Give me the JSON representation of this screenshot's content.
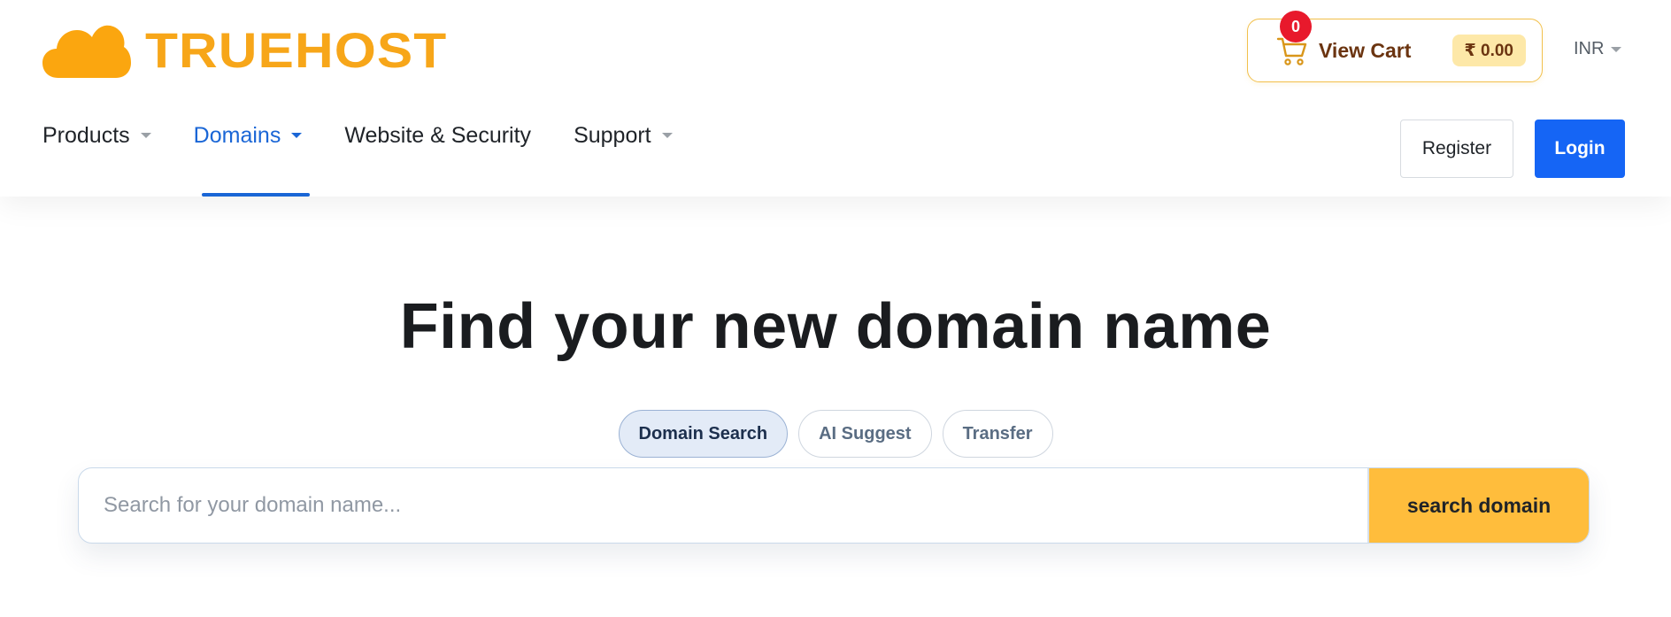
{
  "brand": {
    "name": "TRUEHOST",
    "color": "#f7a619",
    "logo_icon": "cloud-icon"
  },
  "cart": {
    "count": "0",
    "label": "View Cart",
    "total": "₹ 0.00",
    "icon": "shopping-cart-icon"
  },
  "currency": {
    "selected": "INR"
  },
  "nav": {
    "items": [
      {
        "label": "Products",
        "has_dropdown": true,
        "active": false
      },
      {
        "label": "Domains",
        "has_dropdown": true,
        "active": true
      },
      {
        "label": "Website & Security",
        "has_dropdown": false,
        "active": false
      },
      {
        "label": "Support",
        "has_dropdown": true,
        "active": false
      }
    ],
    "register_label": "Register",
    "login_label": "Login"
  },
  "hero": {
    "title": "Find your new domain name",
    "tabs": [
      {
        "label": "Domain Search",
        "selected": true
      },
      {
        "label": "AI Suggest",
        "selected": false
      },
      {
        "label": "Transfer",
        "selected": false
      }
    ],
    "search": {
      "value": "",
      "placeholder": "Search for your domain name...",
      "button_label": "search domain"
    }
  },
  "colors": {
    "primary_blue": "#1565f5",
    "accent_yellow": "#ffbd3c",
    "badge_red": "#e8192c",
    "cart_text": "#6b3410"
  }
}
